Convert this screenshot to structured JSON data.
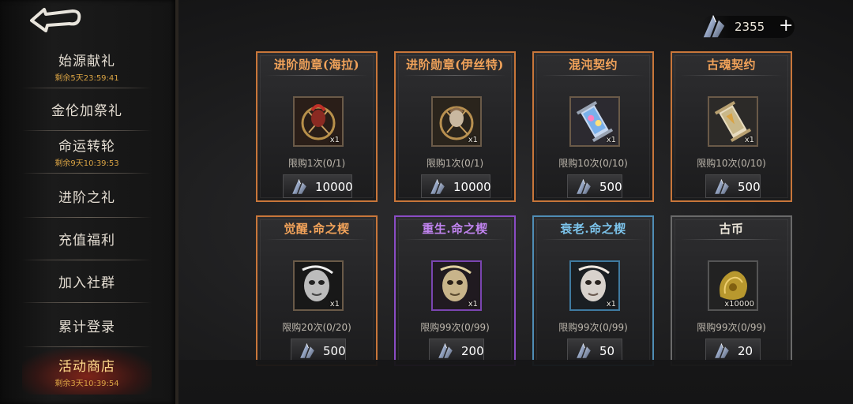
{
  "sidebar": {
    "items": [
      {
        "label": "始源献礼",
        "timer": "剩余5天23:59:41",
        "active": false
      },
      {
        "label": "金伦加祭礼",
        "timer": "",
        "active": false
      },
      {
        "label": "命运转轮",
        "timer": "剩余9天10:39:53",
        "active": false
      },
      {
        "label": "进阶之礼",
        "timer": "",
        "active": false
      },
      {
        "label": "充值福利",
        "timer": "",
        "active": false
      },
      {
        "label": "加入社群",
        "timer": "",
        "active": false
      },
      {
        "label": "累计登录",
        "timer": "",
        "active": false
      },
      {
        "label": "活动商店",
        "timer": "剩余3天10:39:54",
        "active": true
      }
    ]
  },
  "currency": {
    "amount": "2355",
    "plus": "+",
    "icon": "crystal-icon"
  },
  "shop": {
    "cards": [
      {
        "title": "进阶勋章(海拉)",
        "qty": "x1",
        "limit": "限购1次(0/1)",
        "price": "10000",
        "rarity": "orange",
        "item_icon": "medal-hela-icon"
      },
      {
        "title": "进阶勋章(伊丝特)",
        "qty": "x1",
        "limit": "限购1次(0/1)",
        "price": "10000",
        "rarity": "orange",
        "item_icon": "medal-ishtar-icon"
      },
      {
        "title": "混沌契约",
        "qty": "x1",
        "limit": "限购10次(0/10)",
        "price": "500",
        "rarity": "orange",
        "item_icon": "chaos-contract-icon"
      },
      {
        "title": "古魂契约",
        "qty": "x1",
        "limit": "限购10次(0/10)",
        "price": "500",
        "rarity": "orange",
        "item_icon": "ancient-soul-contract-icon"
      },
      {
        "title": "觉醒.命之楔",
        "qty": "x1",
        "limit": "限购20次(0/20)",
        "price": "500",
        "rarity": "orange",
        "item_icon": "mask-awaken-icon"
      },
      {
        "title": "重生.命之楔",
        "qty": "x1",
        "limit": "限购99次(0/99)",
        "price": "200",
        "rarity": "purple",
        "item_icon": "mask-rebirth-icon"
      },
      {
        "title": "衰老.命之楔",
        "qty": "x1",
        "limit": "限购99次(0/99)",
        "price": "50",
        "rarity": "blue",
        "item_icon": "mask-decay-icon"
      },
      {
        "title": "古币",
        "qty": "x10000",
        "limit": "限购99次(0/99)",
        "price": "20",
        "rarity": "gray",
        "item_icon": "ancient-coin-icon"
      }
    ]
  },
  "colors": {
    "orange": "#c8763a",
    "purple": "#8a4cc4",
    "blue": "#4f8db5",
    "gray": "#6a6a6a",
    "timer": "#d9a344"
  }
}
